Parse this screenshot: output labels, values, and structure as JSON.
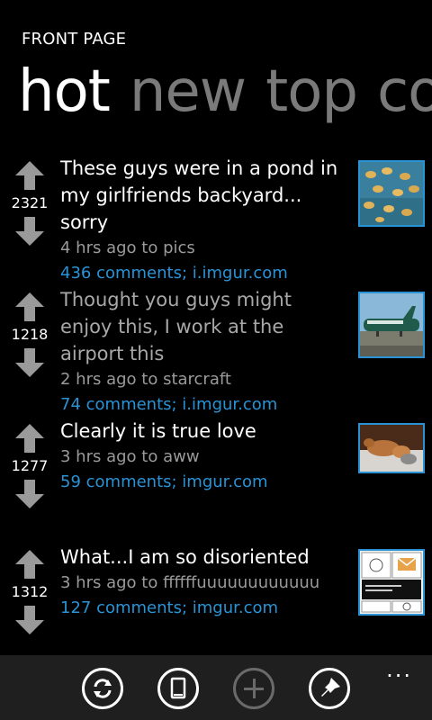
{
  "header": {
    "title": "FRONT PAGE"
  },
  "pivot": {
    "tabs": [
      "hot",
      "new",
      "top",
      "co"
    ]
  },
  "posts": [
    {
      "title": "These guys were in a pond in my girlfriends backyard... sorry",
      "score": "2321",
      "meta": "4 hrs ago to pics",
      "links": "436 comments; i.imgur.com",
      "visited": false,
      "thumb_icon": "ducks-thumbnail"
    },
    {
      "title": "Thought you guys might enjoy this, I work at the airport this",
      "score": "1218",
      "meta": "2 hrs ago to starcraft",
      "links": "74 comments; i.imgur.com",
      "visited": true,
      "thumb_icon": "airplane-thumbnail"
    },
    {
      "title": "Clearly it is true love",
      "score": "1277",
      "meta": "3 hrs ago to aww",
      "links": "59 comments; imgur.com",
      "visited": false,
      "thumb_icon": "dog-thumbnail"
    },
    {
      "title": "What...I am so disoriented",
      "score": "1312",
      "meta": "3 hrs ago to ffffffuuuuuuuuuuuu",
      "links": "127 comments; imgur.com",
      "visited": false,
      "thumb_icon": "comic-thumbnail"
    }
  ],
  "appbar": {
    "buttons": [
      "refresh-icon",
      "tablet-icon",
      "add-icon",
      "pin-icon"
    ],
    "more": "..."
  },
  "colors": {
    "accent": "#2a93d5",
    "background": "#000000",
    "appbar": "#1f1f1f"
  }
}
